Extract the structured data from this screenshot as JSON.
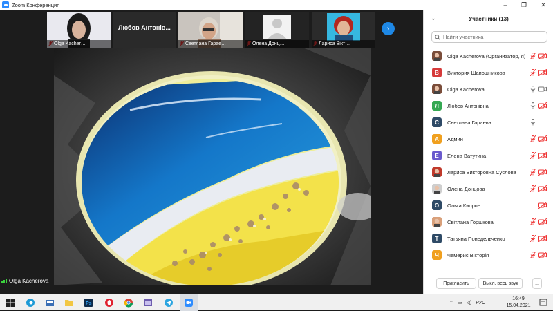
{
  "window": {
    "title": "Zoom Конференция"
  },
  "thumbnails": [
    {
      "name": "Olga Kacher…",
      "type": "photo"
    },
    {
      "name": "Любов Антонів...",
      "type": "name-only"
    },
    {
      "name": "Светлана Гарае…",
      "type": "photo"
    },
    {
      "name": "Олена Донц…",
      "type": "placeholder"
    },
    {
      "name": "Лариса Вікт…",
      "type": "photo"
    }
  ],
  "active_speaker": "Olga Kacherova",
  "panel": {
    "title": "Участники (13)",
    "search_placeholder": "Найти участника",
    "participants": [
      {
        "name": "Olga Kacherova (Организатор, я)",
        "initial": "",
        "avatar_color": "#7a4d3a",
        "photo": true,
        "mic": "muted",
        "cam": "off"
      },
      {
        "name": "Виктория Шапошникова",
        "initial": "В",
        "avatar_color": "#d63a3a",
        "photo": false,
        "mic": "muted",
        "cam": "off"
      },
      {
        "name": "Olga Kacherova",
        "initial": "",
        "avatar_color": "#7a4d3a",
        "photo": true,
        "mic": "on",
        "cam": "on"
      },
      {
        "name": "Любов Антонівна",
        "initial": "Л",
        "avatar_color": "#35a853",
        "photo": false,
        "mic": "on",
        "cam": "off"
      },
      {
        "name": "Светлана Гараева",
        "initial": "С",
        "avatar_color": "#2e4a66",
        "photo": false,
        "mic": "on",
        "cam": "none"
      },
      {
        "name": "Админ",
        "initial": "А",
        "avatar_color": "#f0a01f",
        "photo": false,
        "mic": "muted",
        "cam": "off"
      },
      {
        "name": "Елена Ватутина",
        "initial": "Е",
        "avatar_color": "#6a5acd",
        "photo": false,
        "mic": "muted",
        "cam": "off"
      },
      {
        "name": "Лариса Викторовна Суслова",
        "initial": "",
        "avatar_color": "#c0392b",
        "photo": true,
        "mic": "muted",
        "cam": "off"
      },
      {
        "name": "Олена Донцова",
        "initial": "",
        "avatar_color": "#cfcfcf",
        "photo": true,
        "mic": "muted",
        "cam": "off"
      },
      {
        "name": "Ольга Киорпе",
        "initial": "О",
        "avatar_color": "#2e4a66",
        "photo": false,
        "mic": "none",
        "cam": "off"
      },
      {
        "name": "Світлана Горшкова",
        "initial": "",
        "avatar_color": "#d9a07a",
        "photo": true,
        "mic": "muted",
        "cam": "off"
      },
      {
        "name": "Татьяна Понедельченко",
        "initial": "Т",
        "avatar_color": "#2e4a66",
        "photo": false,
        "mic": "muted",
        "cam": "off"
      },
      {
        "name": "Чемерис Вікторія",
        "initial": "Ч",
        "avatar_color": "#f0a01f",
        "photo": false,
        "mic": "muted",
        "cam": "off"
      }
    ],
    "invite_label": "Пригласить",
    "mute_all_label": "Выкл. весь звук",
    "more_label": "..."
  },
  "taskbar": {
    "language": "РУС",
    "time": "16:49",
    "date": "15.04.2021",
    "apps": [
      "windows-start",
      "edge",
      "task-view",
      "explorer",
      "photoshop",
      "opera",
      "chrome",
      "media",
      "telegram",
      "zoom"
    ]
  }
}
